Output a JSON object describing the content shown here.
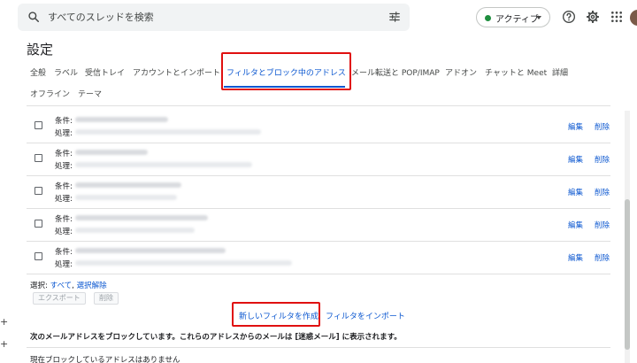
{
  "search": {
    "placeholder": "すべてのスレッドを検索"
  },
  "header": {
    "status_label": "アクティブ",
    "icons": [
      "search-icon",
      "tune-icon",
      "help-icon",
      "gear-icon",
      "apps-icon"
    ]
  },
  "settings": {
    "title": "設定",
    "tabs": [
      {
        "label": "全般"
      },
      {
        "label": "ラベル"
      },
      {
        "label": "受信トレイ"
      },
      {
        "label": "アカウントとインポート"
      },
      {
        "label": "フィルタとブロック中のアドレス"
      },
      {
        "label": "メール転送と POP/IMAP"
      },
      {
        "label": "アドオン"
      },
      {
        "label": "チャットと Meet"
      },
      {
        "label": "詳細"
      },
      {
        "label": "オフライン"
      },
      {
        "label": "テーマ"
      }
    ]
  },
  "filters": {
    "rows": [
      {
        "condition_label": "条件:",
        "action_label": "処理:",
        "edit": "編集",
        "delete": "削除"
      },
      {
        "condition_label": "条件:",
        "action_label": "処理:",
        "edit": "編集",
        "delete": "削除"
      },
      {
        "condition_label": "条件:",
        "action_label": "処理:",
        "edit": "編集",
        "delete": "削除"
      },
      {
        "condition_label": "条件:",
        "action_label": "処理:",
        "edit": "編集",
        "delete": "削除"
      },
      {
        "condition_label": "条件:",
        "action_label": "処理:",
        "edit": "編集",
        "delete": "削除"
      }
    ],
    "select_prefix": "選択: ",
    "select_all": "すべて",
    "select_sep": ", ",
    "select_none": "選択解除",
    "export_label": "エクスポート",
    "delete_label": "削除",
    "create_label": "新しいフィルタを作成",
    "import_label": "フィルタをインポート"
  },
  "blocked": {
    "message": "次のメールアドレスをブロックしています。これらのアドレスからのメールは [迷惑メール] に表示されます。",
    "none_text": "現在ブロックしているアドレスはありません"
  },
  "colors": {
    "accent": "#0b57d0",
    "highlight": "#e01010",
    "status_green": "#1e8e3e"
  }
}
